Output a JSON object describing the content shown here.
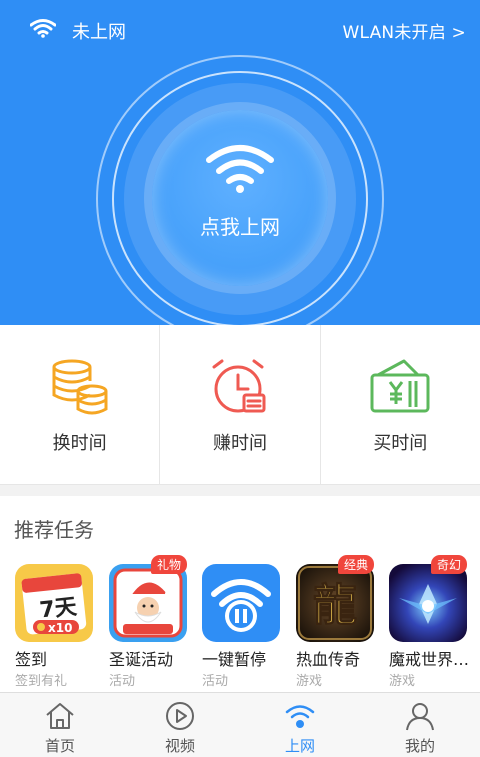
{
  "status_bar": {
    "network_status": "未上网",
    "wlan_link": "WLAN未开启 >"
  },
  "hero": {
    "connect_label": "点我上网"
  },
  "actions": [
    {
      "label": "换时间",
      "icon": "coins-stack-icon",
      "color": "#f5a623"
    },
    {
      "label": "赚时间",
      "icon": "alarm-clock-icon",
      "color": "#ef5a52"
    },
    {
      "label": "买时间",
      "icon": "money-ticket-icon",
      "color": "#5cb85c"
    }
  ],
  "recommended": {
    "title": "推荐任务",
    "apps": [
      {
        "name": "签到",
        "category": "签到有礼",
        "badge": "",
        "icon": "calendar-7days-icon"
      },
      {
        "name": "圣诞活动",
        "category": "活动",
        "badge": "礼物",
        "icon": "santa-claus-icon"
      },
      {
        "name": "一键暂停",
        "category": "活动",
        "badge": "",
        "icon": "wifi-pause-icon"
      },
      {
        "name": "热血传奇",
        "category": "游戏",
        "badge": "经典",
        "icon": "dragon-game-icon"
      },
      {
        "name": "魔戒世界…",
        "category": "游戏",
        "badge": "奇幻",
        "icon": "fantasy-game-icon"
      }
    ]
  },
  "tabbar": [
    {
      "label": "首页",
      "icon": "home-icon",
      "active": false
    },
    {
      "label": "视频",
      "icon": "play-video-icon",
      "active": false
    },
    {
      "label": "上网",
      "icon": "wifi-icon",
      "active": true
    },
    {
      "label": "我的",
      "icon": "user-icon",
      "active": false
    }
  ],
  "colors": {
    "primary_blue": "#2f8ef5",
    "badge_red": "#f0463c"
  }
}
